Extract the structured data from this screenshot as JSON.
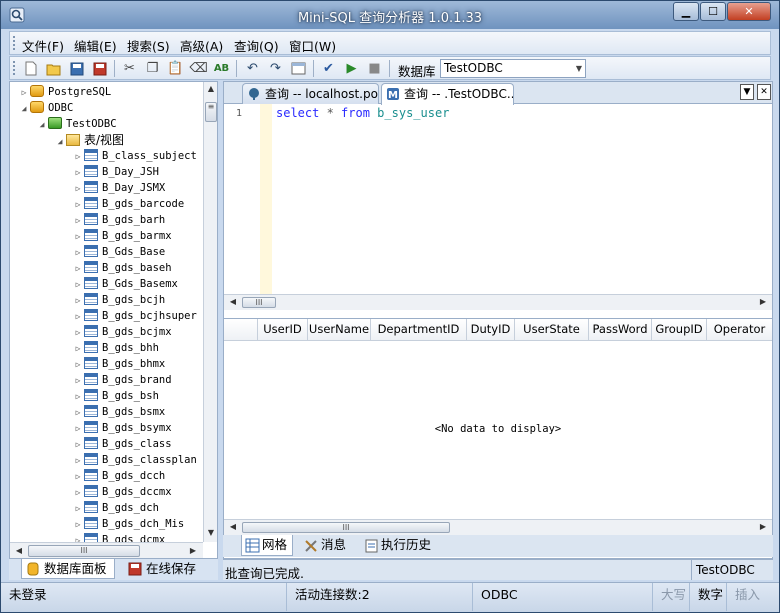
{
  "window": {
    "title": "Mini-SQL 查询分析器 1.0.1.33",
    "minimize_glyph": "▁",
    "maximize_glyph": "☐",
    "close_glyph": "✕"
  },
  "menu": [
    "文件(F)",
    "编辑(E)",
    "搜索(S)",
    "高级(A)",
    "查询(Q)",
    "窗口(W)"
  ],
  "toolbar": {
    "icons": [
      "new-file-icon",
      "open-folder-icon",
      "save-icon",
      "save-all-icon",
      "cut-icon",
      "copy-icon",
      "paste-icon",
      "eraser-icon",
      "spell-check-icon",
      "undo-icon",
      "redo-icon",
      "panel-icon",
      "check-icon",
      "run-icon",
      "stop-icon"
    ],
    "database_label": "数据库",
    "database_value": "TestODBC"
  },
  "tree": {
    "servers": [
      {
        "label": "PostgreSQL",
        "expanded": false
      },
      {
        "label": "ODBC",
        "expanded": true
      }
    ],
    "database": "TestODBC",
    "folder": "表/视图",
    "tables": [
      "B_class_subject",
      "B_Day_JSH",
      "B_Day_JSMX",
      "B_gds_barcode",
      "B_gds_barh",
      "B_gds_barmx",
      "B_Gds_Base",
      "B_gds_baseh",
      "B_Gds_Basemx",
      "B_gds_bcjh",
      "B_gds_bcjhsuper",
      "B_gds_bcjmx",
      "B_gds_bhh",
      "B_gds_bhmx",
      "B_gds_brand",
      "B_gds_bsh",
      "B_gds_bsmx",
      "B_gds_bsymx",
      "B_gds_class",
      "B_gds_classplan",
      "B_gds_dcch",
      "B_gds_dccmx",
      "B_gds_dch",
      "B_gds_dch_Mis",
      "B_gds_dcmx"
    ]
  },
  "left_tabs": [
    "数据库面板",
    "在线保存"
  ],
  "editor_tabs": [
    "查询 -- localhost.po...",
    "查询 -- .TestODBC...."
  ],
  "editor": {
    "line_number": "1",
    "code": {
      "kw1": "select",
      "star": " * ",
      "kw2": "from",
      "table": " b_sys_user"
    }
  },
  "grid": {
    "columns": [
      "UserID",
      "UserName",
      "DepartmentID",
      "DutyID",
      "UserState",
      "PassWord",
      "GroupID",
      "Operator"
    ],
    "empty_text": "<No data to display>"
  },
  "bottom_tabs": [
    "网格",
    "消息",
    "执行历史"
  ],
  "messages": {
    "text": "批查询已完成.",
    "db": "TestODBC"
  },
  "status": {
    "login": "未登录",
    "connections": "活动连接数:2",
    "driver": "ODBC",
    "caps": "大写",
    "num": "数字",
    "insert": "插入"
  },
  "scroll_thumb_glyph": "III",
  "colors": {
    "title_bar": "#7a9cc6",
    "keyword": "#2a2aff",
    "table_name": "#1a8f8f"
  }
}
